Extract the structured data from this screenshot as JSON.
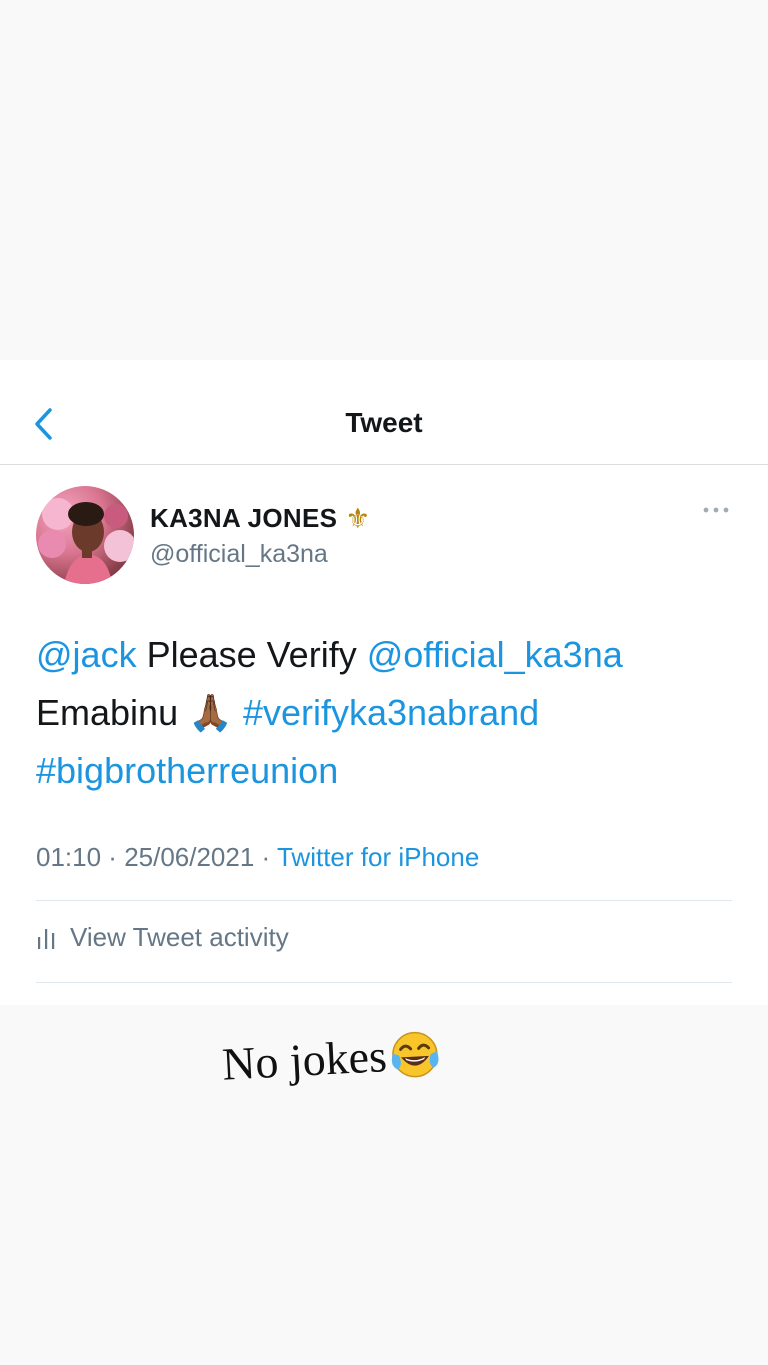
{
  "nav": {
    "title": "Tweet",
    "back_icon": "chevron-left-icon"
  },
  "tweet": {
    "display_name": "KA3NA JONES",
    "name_emoji": "⚜",
    "handle": "@official_ka3na",
    "body": {
      "mention_1": "@jack",
      "text_1": " Please Verify ",
      "mention_2": "@official_ka3na",
      "text_2": "Emabinu ",
      "emoji": "🙏🏾",
      "hashtag_1": "#verifyka3nabrand",
      "hashtag_2": "#bigbrotherreunion"
    },
    "time": "01:10",
    "date": "25/06/2021",
    "separator": " · ",
    "source": "Twitter for iPhone",
    "activity_label": "View Tweet activity"
  },
  "caption": {
    "text": "No jokes",
    "emoji": "face-with-tears-of-joy"
  },
  "colors": {
    "link": "#1b95e0",
    "text": "#14171a",
    "secondary": "#657786"
  }
}
